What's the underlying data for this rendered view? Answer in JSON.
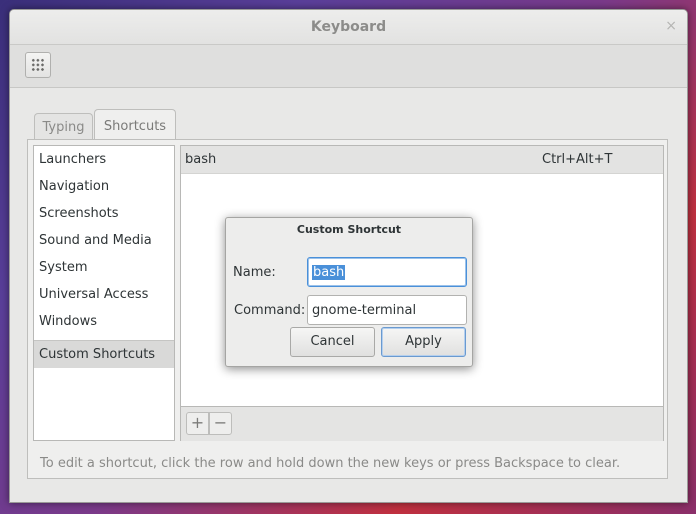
{
  "window": {
    "title": "Keyboard",
    "close_glyph": "×"
  },
  "toolbar": {
    "overview_icon": "grid-icon"
  },
  "tabs": [
    {
      "label": "Typing",
      "active": false
    },
    {
      "label": "Shortcuts",
      "active": true
    }
  ],
  "categories": [
    {
      "label": "Launchers"
    },
    {
      "label": "Navigation"
    },
    {
      "label": "Screenshots"
    },
    {
      "label": "Sound and Media"
    },
    {
      "label": "System"
    },
    {
      "label": "Universal Access"
    },
    {
      "label": "Windows"
    },
    {
      "label": "Custom Shortcuts",
      "selected": true
    }
  ],
  "shortcuts": [
    {
      "name": "bash",
      "keys": "Ctrl+Alt+T"
    }
  ],
  "list_toolbar": {
    "add": "+",
    "remove": "−"
  },
  "hint": "To edit a shortcut, click the row and hold down the new keys or press Backspace to clear.",
  "dialog": {
    "title": "Custom Shortcut",
    "name_label": "Name:",
    "name_value": "bash",
    "command_label": "Command:",
    "command_value": "gnome-terminal",
    "cancel_label": "Cancel",
    "apply_label": "Apply"
  },
  "colors": {
    "accent": "#4a90d9",
    "selection": "#4a90d9"
  }
}
